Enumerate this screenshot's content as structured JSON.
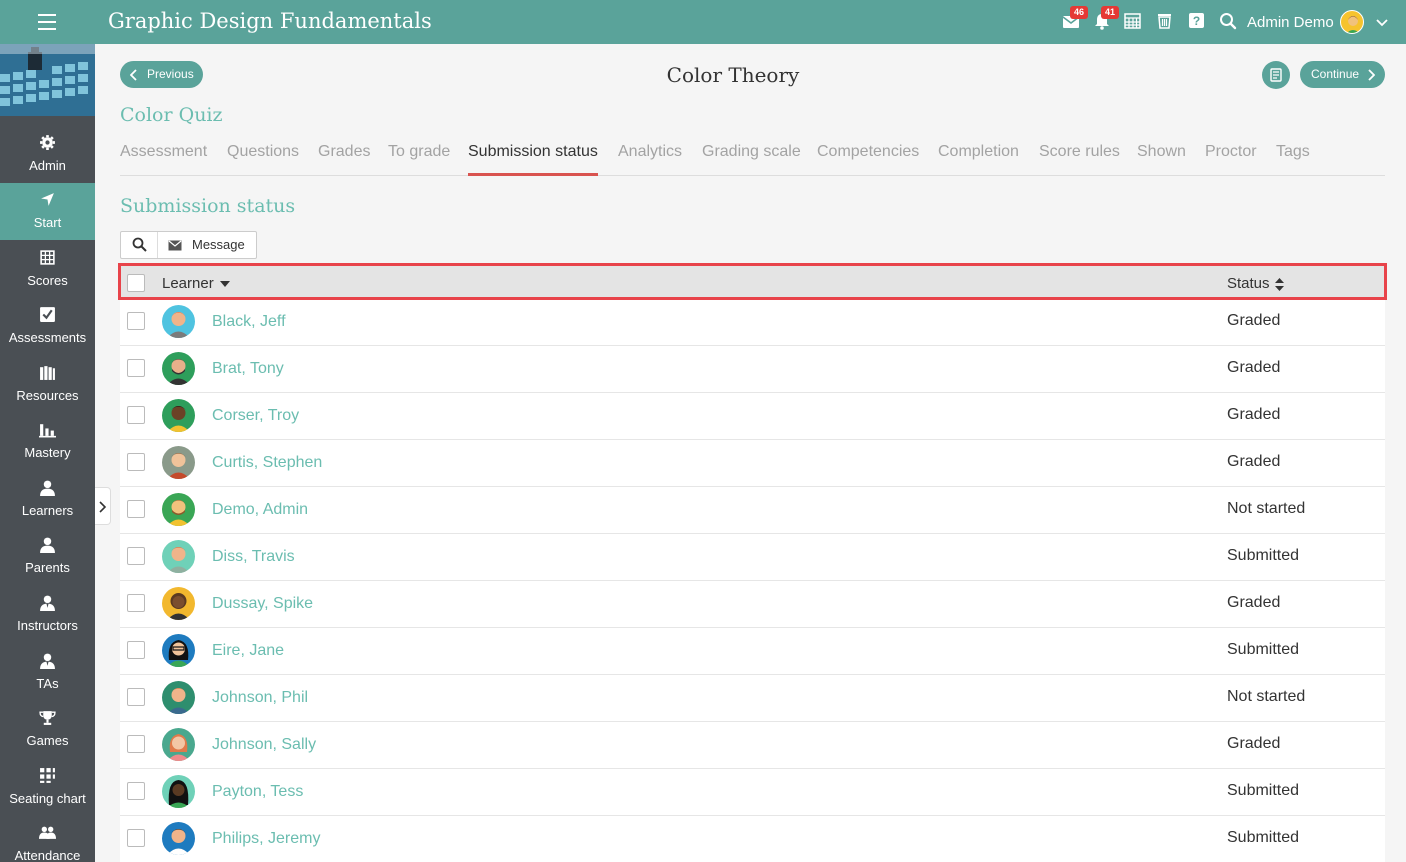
{
  "header": {
    "app_title": "Graphic Design Fundamentals",
    "mail_badge": "46",
    "notification_badge": "41",
    "user_name": "Admin Demo"
  },
  "sidebar": {
    "items": [
      {
        "label": "Admin",
        "icon": "gear-icon"
      },
      {
        "label": "Start",
        "icon": "location-arrow-icon",
        "active": true
      },
      {
        "label": "Scores",
        "icon": "gradebook-icon"
      },
      {
        "label": "Assessments",
        "icon": "checkbox-icon"
      },
      {
        "label": "Resources",
        "icon": "books-icon"
      },
      {
        "label": "Mastery",
        "icon": "bar-chart-icon"
      },
      {
        "label": "Learners",
        "icon": "user-icon"
      },
      {
        "label": "Parents",
        "icon": "user-icon"
      },
      {
        "label": "Instructors",
        "icon": "instructor-icon"
      },
      {
        "label": "TAs",
        "icon": "instructor-icon"
      },
      {
        "label": "Games",
        "icon": "trophy-icon"
      },
      {
        "label": "Seating chart",
        "icon": "grid-icon"
      },
      {
        "label": "Attendance",
        "icon": "group-icon"
      }
    ]
  },
  "nav": {
    "previous_label": "Previous",
    "continue_label": "Continue",
    "page_title": "Color Theory"
  },
  "quiz_title": "Color Quiz",
  "tabs": [
    {
      "label": "Assessment"
    },
    {
      "label": "Questions"
    },
    {
      "label": "Grades"
    },
    {
      "label": "To grade"
    },
    {
      "label": "Submission status",
      "active": true
    },
    {
      "label": "Analytics"
    },
    {
      "label": "Grading scale"
    },
    {
      "label": "Competencies"
    },
    {
      "label": "Completion"
    },
    {
      "label": "Score rules"
    },
    {
      "label": "Shown"
    },
    {
      "label": "Proctor"
    },
    {
      "label": "Tags"
    }
  ],
  "section_title": "Submission status",
  "toolbar": {
    "message_label": "Message"
  },
  "table": {
    "columns": {
      "learner": "Learner",
      "status": "Status"
    },
    "rows": [
      {
        "name": "Black, Jeff",
        "status": "Graded"
      },
      {
        "name": "Brat, Tony",
        "status": "Graded"
      },
      {
        "name": "Corser, Troy",
        "status": "Graded"
      },
      {
        "name": "Curtis, Stephen",
        "status": "Graded"
      },
      {
        "name": "Demo, Admin",
        "status": "Not started"
      },
      {
        "name": "Diss, Travis",
        "status": "Submitted"
      },
      {
        "name": "Dussay, Spike",
        "status": "Graded"
      },
      {
        "name": "Eire, Jane",
        "status": "Submitted"
      },
      {
        "name": "Johnson, Phil",
        "status": "Not started"
      },
      {
        "name": "Johnson, Sally",
        "status": "Graded"
      },
      {
        "name": "Payton, Tess",
        "status": "Submitted"
      },
      {
        "name": "Philips, Jeremy",
        "status": "Submitted"
      }
    ]
  },
  "colors": {
    "brand": "#5aa39a",
    "accent_text": "#6bbdb0",
    "active_tab_underline": "#d9534f",
    "highlight_box": "#e8434a",
    "sidebar_bg": "#4a4f54"
  }
}
